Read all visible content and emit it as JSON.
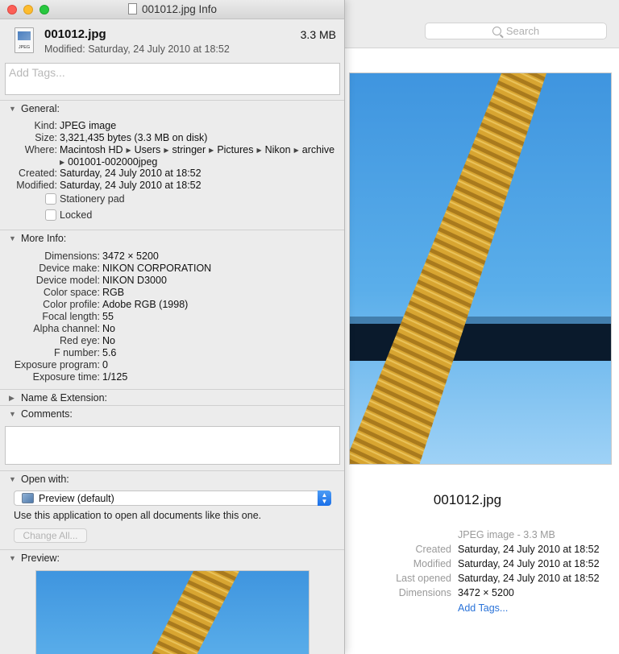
{
  "colors": {
    "accent": "#2a73d9",
    "sky": "#4ea3e6",
    "rope": "#d8a531",
    "close": "#fc5f57",
    "minimize": "#fdbc2e",
    "zoom": "#28c840"
  },
  "finder": {
    "search_placeholder": "Search",
    "filename": "001012.jpg",
    "kind_size": "JPEG image - 3.3 MB",
    "info": [
      {
        "label": "Created",
        "value": "Saturday, 24 July 2010 at 18:52"
      },
      {
        "label": "Modified",
        "value": "Saturday, 24 July 2010 at 18:52"
      },
      {
        "label": "Last opened",
        "value": "Saturday, 24 July 2010 at 18:52"
      },
      {
        "label": "Dimensions",
        "value": "3472 × 5200"
      }
    ],
    "add_tags": "Add Tags..."
  },
  "window": {
    "title": "001012.jpg Info",
    "file_icon_label": "JPEG",
    "filename": "001012.jpg",
    "size": "3.3 MB",
    "modified": "Modified: Saturday, 24 July 2010 at 18:52",
    "tags_placeholder": "Add Tags..."
  },
  "general": {
    "title": "General:",
    "kind_label": "Kind:",
    "kind": "JPEG image",
    "size_label": "Size:",
    "size": "3,321,435 bytes (3.3 MB on disk)",
    "where_label": "Where:",
    "where_path": [
      "Macintosh HD",
      "Users",
      "stringer",
      "Pictures",
      "Nikon",
      "archive"
    ],
    "where_path_last": "001001-002000jpeg",
    "created_label": "Created:",
    "created": "Saturday, 24 July 2010 at 18:52",
    "modified_label": "Modified:",
    "modified": "Saturday, 24 July 2010 at 18:52",
    "stationery": "Stationery pad",
    "locked": "Locked"
  },
  "more_info": {
    "title": "More Info:",
    "rows": [
      {
        "label": "Dimensions:",
        "value": "3472 × 5200"
      },
      {
        "label": "Device make:",
        "value": "NIKON CORPORATION"
      },
      {
        "label": "Device model:",
        "value": "NIKON D3000"
      },
      {
        "label": "Color space:",
        "value": "RGB"
      },
      {
        "label": "Color profile:",
        "value": "Adobe RGB (1998)"
      },
      {
        "label": "Focal length:",
        "value": "55"
      },
      {
        "label": "Alpha channel:",
        "value": "No"
      },
      {
        "label": "Red eye:",
        "value": "No"
      },
      {
        "label": "F number:",
        "value": "5.6"
      },
      {
        "label": "Exposure program:",
        "value": "0"
      },
      {
        "label": "Exposure time:",
        "value": "1/125"
      }
    ]
  },
  "name_extension": {
    "title": "Name & Extension:"
  },
  "comments": {
    "title": "Comments:"
  },
  "open_with": {
    "title": "Open with:",
    "app": "Preview (default)",
    "note": "Use this application to open all documents like this one.",
    "change_all": "Change All..."
  },
  "preview": {
    "title": "Preview:"
  }
}
